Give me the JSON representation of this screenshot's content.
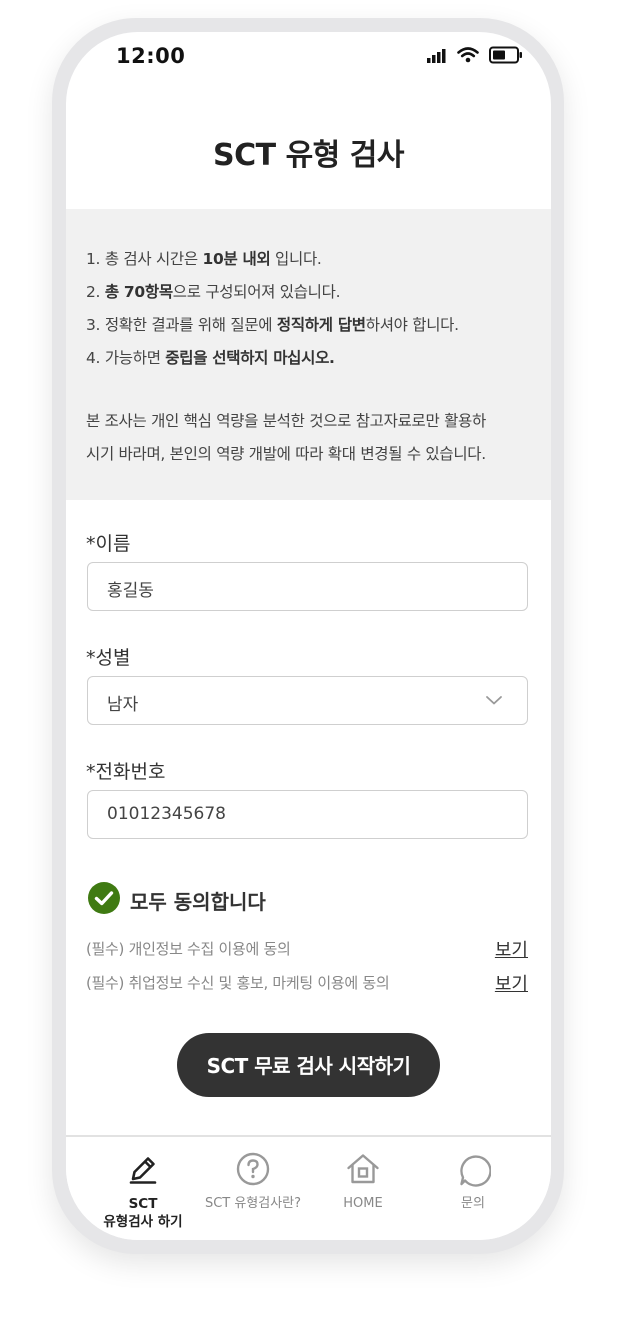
{
  "status_bar": {
    "time": "12:00"
  },
  "header": {
    "title": "SCT 유형 검사"
  },
  "notice": {
    "lines": [
      {
        "before": "1. 총 검사 시간은 ",
        "bold": "10분 내외",
        "after": " 입니다."
      },
      {
        "before": "2. ",
        "bold": "총 70항목",
        "after": "으로 구성되어져 있습니다."
      },
      {
        "before": "3. 정확한 결과를 위해 질문에 ",
        "bold": "정직하게 답변",
        "after": "하셔야 합니다."
      },
      {
        "before": "4. 가능하면 ",
        "bold": "중립을 선택하지 마십시오.",
        "after": ""
      }
    ],
    "paragraph": [
      "본 조사는 개인 핵심 역량을 분석한 것으로 참고자료로만 활용하",
      "시기 바라며, 본인의 역량 개발에 따라 확대 변경될 수 있습니다."
    ]
  },
  "form": {
    "name": {
      "label": "*이름",
      "value": "홍길동"
    },
    "gender": {
      "label": "*성별",
      "value": "남자"
    },
    "phone": {
      "label": "*전화번호",
      "value": "01012345678"
    }
  },
  "consent": {
    "agree_all_label": "모두 동의합니다",
    "agree_all_checked": true,
    "check_color": "#3f7a12",
    "items": [
      {
        "label": "(필수) 개인정보 수집 이용에 동의",
        "view": "보기"
      },
      {
        "label": "(필수) 취업정보 수신 및 홍보, 마케팅 이용에 동의",
        "view": "보기"
      }
    ]
  },
  "start_button": {
    "label": "SCT 무료 검사 시작하기",
    "color": "#333333"
  },
  "bottom_nav": {
    "items": [
      {
        "label_line1": "SCT",
        "label_line2": "유형검사 하기",
        "icon": "pencil-icon",
        "active": true
      },
      {
        "label": "SCT 유형검사란?",
        "icon": "question-circle-icon"
      },
      {
        "label": "HOME",
        "icon": "home-icon"
      },
      {
        "label": "문의",
        "icon": "chat-bubble-icon"
      }
    ]
  }
}
